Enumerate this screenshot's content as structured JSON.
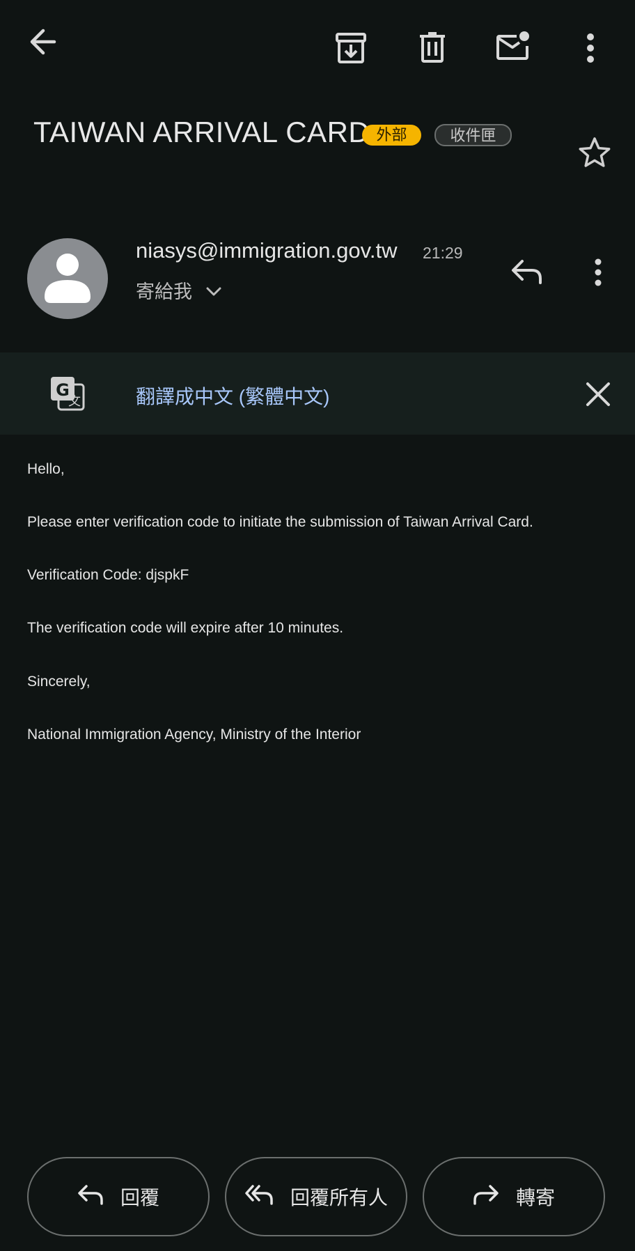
{
  "toolbar": {
    "back_icon": "arrow-back-icon",
    "archive_icon": "archive-icon",
    "delete_icon": "trash-icon",
    "mark_unread_icon": "mark-unread-icon",
    "more_icon": "more-vert-icon"
  },
  "email": {
    "subject": "TAIWAN ARRIVAL CARD",
    "labels": {
      "external": "外部",
      "inbox": "收件匣"
    },
    "sender": "niasys@immigration.gov.tw",
    "time": "21:29",
    "recipient": "寄給我"
  },
  "translate": {
    "link_text": "翻譯成中文 (繁體中文)"
  },
  "body": {
    "lines": [
      "Hello,",
      "Please enter verification code to initiate the submission of Taiwan Arrival Card.",
      "Verification Code: djspkF",
      "The verification code will expire after 10 minutes.",
      "Sincerely,",
      "National Immigration Agency, Ministry of the Interior"
    ]
  },
  "actions": {
    "reply": "回覆",
    "reply_all": "回覆所有人",
    "forward": "轉寄"
  },
  "colors": {
    "background": "#0f1413",
    "external_chip": "#f5b400",
    "translate_link": "#a8c7fa",
    "avatar": "#8a8d91"
  }
}
